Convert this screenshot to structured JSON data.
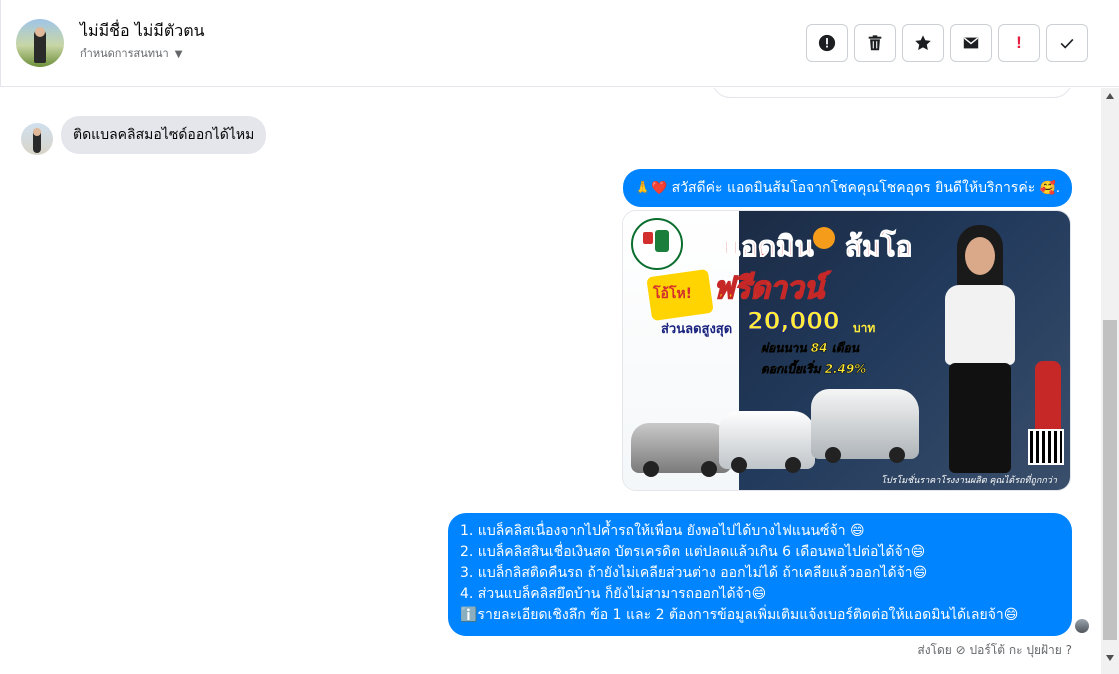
{
  "header": {
    "contact_name": "ไม่มีชื่อ ไม่มีตัวตน",
    "subtitle": "กำหนดการสนทนา",
    "actions": [
      "alert-icon",
      "trash-icon",
      "star-icon",
      "mail-icon",
      "flag-important-icon",
      "check-icon"
    ],
    "important_mark": "!"
  },
  "messages": {
    "incoming": "ติดแบลคลิสมอไซด์ออกได้ไหม",
    "greeting_emoji": "🙏❤️",
    "greeting": "สวัสดีค่ะ แอดมินส้มโอจากโชคคุณโชคอุดร ยินดีให้บริการค่ะ",
    "greeting_end_emoji": "🥰.",
    "promo": {
      "title_left": "แอดมิน",
      "title_right": "ส้มโอ",
      "badge": "โอ้โห!",
      "headline": "ฟรีดาวน์",
      "discount_label": "ส่วนลดสูงสุด",
      "amount": "20,000",
      "currency": "บาท",
      "installment": "ผ่อนนาน 84 เดือน",
      "interest": "ดอกเบี้ยเริ่ม 2.49%",
      "footer": "โปรโมชั่นราคาโรงงานผลิต คุณได้รถที่ถูกกว่า"
    },
    "reply_lines": [
      "1. แบล็คลิสเนื่องจากไปค้ำรถให้เพื่อน ยังพอไปได้บางไฟแนนซ์จ้า 😄",
      "2. แบล็คลิสสินเชื่อเงินสด บัตรเครดิต แต่ปลดแล้วเกิน 6 เดือนพอไปต่อได้จ้า😄",
      "3. แบล็กลิสติดคืนรถ ถ้ายังไม่เคลียส่วนต่าง ออกไม่ได้ ถ้าเคลียแล้วออกได้จ้า😄",
      "4. ส่วนแบล็คลิสยึดบ้าน ก็ยังไม่สามารถออกได้จ้า😄",
      "ℹ️รายละเอียดเชิงลึก ข้อ 1 และ 2 ต้องการข้อมูลเพิ่มเติมแจ้งเบอร์ติดต่อให้แอดมินได้เลยจ้า😄"
    ],
    "sent_by": "ส่งโดย ⊘ ปอร์โต้ กะ ปุยฝ้าย ?"
  },
  "colors": {
    "outgoing_bubble": "#0084ff",
    "incoming_bubble": "#e4e6eb",
    "important": "#e41e3f"
  }
}
